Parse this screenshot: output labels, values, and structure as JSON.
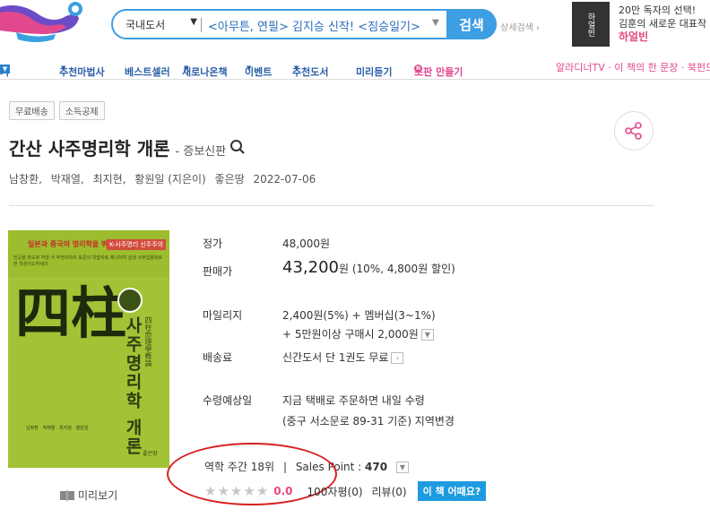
{
  "header": {
    "search": {
      "category": "국내도서",
      "query": "<아무튼, 연필> 김지승 신작! <짐승일기>",
      "button_label": "검색",
      "detail_search": "상세검색"
    },
    "ad": {
      "book_text": "하얼빈",
      "line1": "20만 독자의 선택!",
      "line2": "김훈의 새로운 대표작",
      "title": "하얼빈"
    }
  },
  "nav": {
    "items": [
      {
        "label": "기"
      },
      {
        "label": "추천마법사"
      },
      {
        "label": "베스트셀러"
      },
      {
        "label": "새로나온책"
      },
      {
        "label": "이벤트"
      },
      {
        "label": "추천도서"
      },
      {
        "label": "미리듣기"
      },
      {
        "label": "초판 만들기"
      }
    ],
    "right": "알라디너TV · 이 책의 한 문장 · 북펀드"
  },
  "product": {
    "badges": [
      "무료배송",
      "소득공제"
    ],
    "title": "간산 사주명리학 개론",
    "subtitle": "- 증보신판",
    "authors": [
      "남창환,",
      "박재열,",
      "최지현,",
      "황원일 (지은이)",
      "좋은땅",
      "2022-07-06"
    ],
    "cover": {
      "top_red": "일본과 중국의 명리학을 뛰어 넘은",
      "tag": "K-사주명리 신주주의",
      "small_text": "전공을 파도로 하였 사 주명리학의 표준의 학습자료 제시하여 실생 사주업용화로 본 학생지도하세의",
      "han": "四柱",
      "korean": "사주명리학 개론",
      "hanja": "四柱命理學槪論",
      "cover_authors": "남창환 · 박재열 · 최지현 · 황원일",
      "publisher": "좋은땅"
    },
    "preview_label": "미리보기",
    "info": {
      "list_price_label": "정가",
      "list_price": "48,000원",
      "sale_price_label": "판매가",
      "sale_price": "43,200",
      "sale_price_unit": "원",
      "discount": "(10%, 4,800원 할인)",
      "mileage_label": "마일리지",
      "mileage1": "2,400원(5%) + 멤버십(3~1%)",
      "mileage2": "+ 5만원이상 구매시 2,000원",
      "shipping_label": "배송료",
      "shipping": "신간도서 단 1권도 무료",
      "delivery_label": "수령예상일",
      "delivery1": "지금 택배로 주문하면 내일 수령",
      "delivery2": "(중구 서소문로 89-31 기준) 지역변경"
    },
    "rank": {
      "text": "역학 주간 18위",
      "divider": "|",
      "sales_label": "Sales Point :",
      "sales_value": "470"
    },
    "rating": {
      "stars": 0,
      "score": "0.0",
      "reviews100": "100자평(0)",
      "reviews": "리뷰(0)",
      "how_button": "이 책 어때요?"
    }
  }
}
